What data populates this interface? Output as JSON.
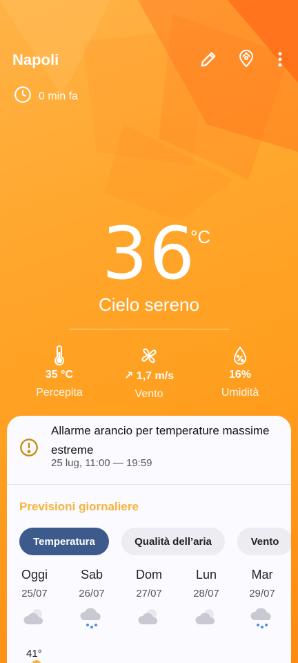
{
  "header": {
    "city": "Napoli"
  },
  "updated": {
    "text": "0 min fa"
  },
  "current": {
    "temperature": "36",
    "unit": "°C",
    "condition": "Cielo sereno"
  },
  "stats": [
    {
      "value": "35 °C",
      "label": "Percepita",
      "icon": "thermometer-icon"
    },
    {
      "value": "↗ 1,7 m/s",
      "label": "Vento",
      "icon": "fan-icon"
    },
    {
      "value": "16%",
      "label": "Umidità",
      "icon": "humidity-drop-icon"
    }
  ],
  "alert": {
    "title": "Allarme arancio per temperature massime estreme",
    "time": "25 lug, 11:00 — 19:59"
  },
  "forecast": {
    "title": "Previsioni giornaliere",
    "chips": [
      "Temperatura",
      "Qualità dell’aria",
      "Vento"
    ],
    "days": [
      {
        "name": "Oggi",
        "date": "25/07",
        "icon": "partly-cloudy-icon"
      },
      {
        "name": "Sab",
        "date": "26/07",
        "icon": "rain-icon"
      },
      {
        "name": "Dom",
        "date": "27/07",
        "icon": "partly-cloudy-icon"
      },
      {
        "name": "Lun",
        "date": "28/07",
        "icon": "partly-cloudy-icon"
      },
      {
        "name": "Mar",
        "date": "29/07",
        "icon": "rain-icon"
      }
    ],
    "first_high": "41°"
  },
  "colors": {
    "accent_orange": "#ff9f1f",
    "forecast_title": "#f5b43c",
    "active_chip": "#3c5b8c"
  }
}
